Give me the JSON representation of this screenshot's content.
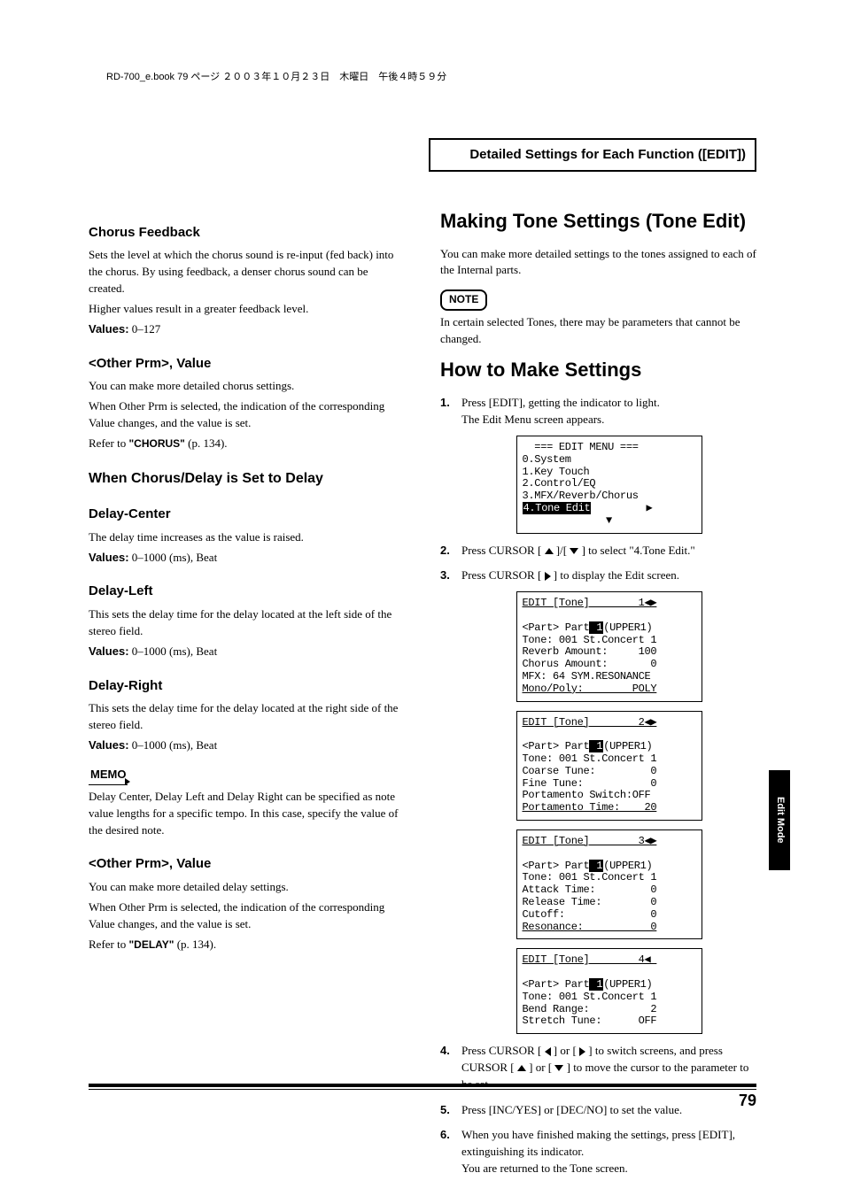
{
  "header": {
    "bookline": "RD-700_e.book  79 ページ  ２００３年１０月２３日　木曜日　午後４時５９分"
  },
  "section_title": "Detailed Settings for Each Function ([EDIT])",
  "left": {
    "chorus_feedback": {
      "title": "Chorus Feedback",
      "p1": "Sets the level at which the chorus sound is re-input (fed back) into the chorus. By using feedback, a denser chorus sound can be created.",
      "p2": "Higher values result in a greater feedback level.",
      "values_label": "Values:",
      "values": "0–127"
    },
    "other_prm1": {
      "title": "<Other Prm>, Value",
      "p1": "You can make more detailed chorus settings.",
      "p2": "When Other Prm is selected, the indication of the corresponding Value changes, and the value is set.",
      "ref_pre": "Refer to ",
      "ref_quote": "\"CHORUS\"",
      "ref_post": " (p. 134)."
    },
    "when_delay": {
      "title": "When Chorus/Delay is Set to Delay"
    },
    "delay_center": {
      "title": "Delay-Center",
      "p1": "The delay time increases as the value is raised.",
      "values_label": "Values:",
      "values": "0–1000 (ms), Beat"
    },
    "delay_left": {
      "title": "Delay-Left",
      "p1": "This sets the delay time for the delay located at the left side of the stereo field.",
      "values_label": "Values:",
      "values": "0–1000 (ms), Beat"
    },
    "delay_right": {
      "title": "Delay-Right",
      "p1": "This sets the delay time for the delay located at the right side of the stereo field.",
      "values_label": "Values:",
      "values": "0–1000 (ms), Beat"
    },
    "memo": {
      "label": "MEMO",
      "p1": "Delay Center, Delay Left and Delay Right can be specified as note value lengths for a specific tempo. In this case, specify the value of the desired note."
    },
    "other_prm2": {
      "title": "<Other Prm>, Value",
      "p1": "You can make more detailed delay settings.",
      "p2": "When Other Prm is selected, the indication of the corresponding Value changes, and the value is set.",
      "ref_pre": "Refer to ",
      "ref_quote": "\"DELAY\"",
      "ref_post": " (p. 134)."
    }
  },
  "right": {
    "making_tone": {
      "title": "Making Tone Settings (Tone Edit)",
      "p1": "You can make more detailed settings to the tones assigned to each of the Internal parts."
    },
    "note": {
      "label": "NOTE",
      "p1": "In certain selected Tones, there may be parameters that cannot be changed."
    },
    "how_to": {
      "title": "How to Make Settings"
    },
    "steps": {
      "s1a": "Press [EDIT], getting the indicator to light.",
      "s1b": "The Edit Menu screen appears.",
      "s2a": "Press CURSOR [ ",
      "s2b": " ]/[ ",
      "s2c": " ] to select \"4.Tone Edit.\"",
      "s3a": "Press CURSOR [ ",
      "s3b": " ] to display the Edit screen.",
      "s4a": "Press CURSOR [ ",
      "s4b": " ] or [ ",
      "s4c": " ] to switch screens, and press CURSOR [ ",
      "s4d": " ] or [ ",
      "s4e": " ] to move the cursor to the parameter to be set.",
      "s5": "Press [INC/YES] or [DEC/NO] to set the value.",
      "s6a": "When you have finished making the settings, press [EDIT], extinguishing its indicator.",
      "s6b": "You are returned to the Tone screen."
    },
    "lcd1": {
      "l1": "  === EDIT MENU ===",
      "l2": "0.System",
      "l3": "1.Key Touch",
      "l4": "2.Control/EQ",
      "l5": "3.MFX/Reverb/Chorus",
      "l6a": "4.Tone Edit",
      "l6b": "         ▶",
      "arrow": "▼"
    },
    "lcd2": {
      "l1": "EDIT [Tone]        1◀▶",
      "l2a": "<Part> Part",
      "l2b": "(UPPER1)",
      "l3": "Tone: 001 St.Concert 1",
      "l4": "Reverb Amount:     100",
      "l5": "Chorus Amount:       0",
      "l6": "MFX: 64 SYM.RESONANCE",
      "l7": "Mono/Poly:        POLY"
    },
    "lcd3": {
      "l1": "EDIT [Tone]        2◀▶",
      "l2a": "<Part> Part",
      "l2b": "(UPPER1)",
      "l3": "Tone: 001 St.Concert 1",
      "l4": "Coarse Tune:         0",
      "l5": "Fine Tune:           0",
      "l6": "Portamento Switch:OFF",
      "l7": "Portamento Time:    20"
    },
    "lcd4": {
      "l1": "EDIT [Tone]        3◀▶",
      "l2a": "<Part> Part",
      "l2b": "(UPPER1)",
      "l3": "Tone: 001 St.Concert 1",
      "l4": "Attack Time:         0",
      "l5": "Release Time:        0",
      "l6": "Cutoff:              0",
      "l7": "Resonance:           0"
    },
    "lcd5": {
      "l1": "EDIT [Tone]        4◀ ",
      "l2a": "<Part> Part",
      "l2b": "(UPPER1)",
      "l3": "Tone: 001 St.Concert 1",
      "l4": "Bend Range:          2",
      "l5": "Stretch Tune:      OFF"
    }
  },
  "side_tab": "Edit Mode",
  "page_number": "79"
}
